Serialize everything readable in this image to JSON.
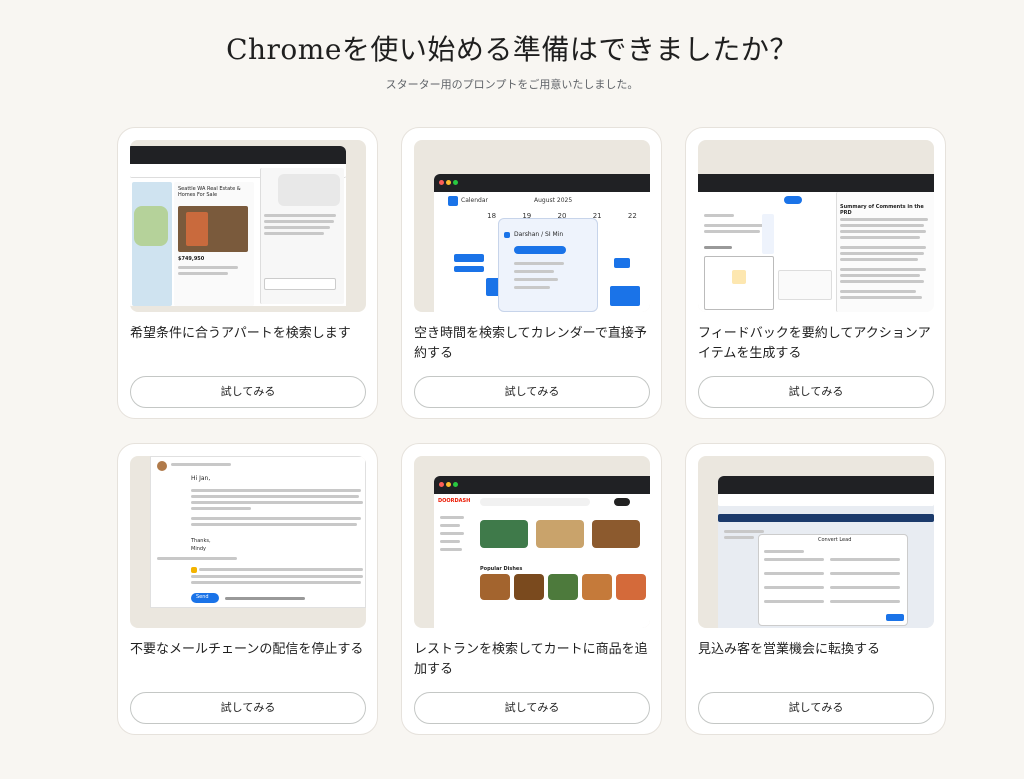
{
  "header": {
    "title": "Chromeを使い始める準備はできましたか？",
    "subtitle": "スターター用のプロンプトをご用意いたしました。"
  },
  "cards": [
    {
      "label": "希望条件に合うアパートを検索します",
      "button": "試してみる",
      "thumb": {
        "app_text": "Seattle WA Real Estate & Homes For Sale",
        "price": "$749,950"
      }
    },
    {
      "label": "空き時間を検索してカレンダーで直接予約する",
      "button": "試してみる",
      "thumb": {
        "app_text": "Calendar",
        "month": "August 2025",
        "days": [
          "18",
          "19",
          "20",
          "21",
          "22"
        ],
        "event": "Darshan / SI Min"
      }
    },
    {
      "label": "フィードバックを要約してアクションアイテムを生成する",
      "button": "試してみる",
      "thumb": {
        "app_text": "Summary of Comments in the PRD"
      }
    },
    {
      "label": "不要なメールチェーンの配信を停止する",
      "button": "試してみる",
      "thumb": {
        "app_text": "Hi Jan,",
        "sign": "Thanks, Mindy",
        "send": "Send"
      }
    },
    {
      "label": "レストランを検索してカートに商品を追加する",
      "button": "試してみる",
      "thumb": {
        "app_text": "DOORDASH",
        "section": "Popular Dishes"
      }
    },
    {
      "label": "見込み客を営業機会に転換する",
      "button": "試してみる",
      "thumb": {
        "app_text": "Convert Lead"
      }
    }
  ],
  "colors": {
    "background": "#f8f6f2",
    "card": "#ffffff",
    "accent_blue": "#1a73e8",
    "doordash_red": "#eb1700"
  }
}
